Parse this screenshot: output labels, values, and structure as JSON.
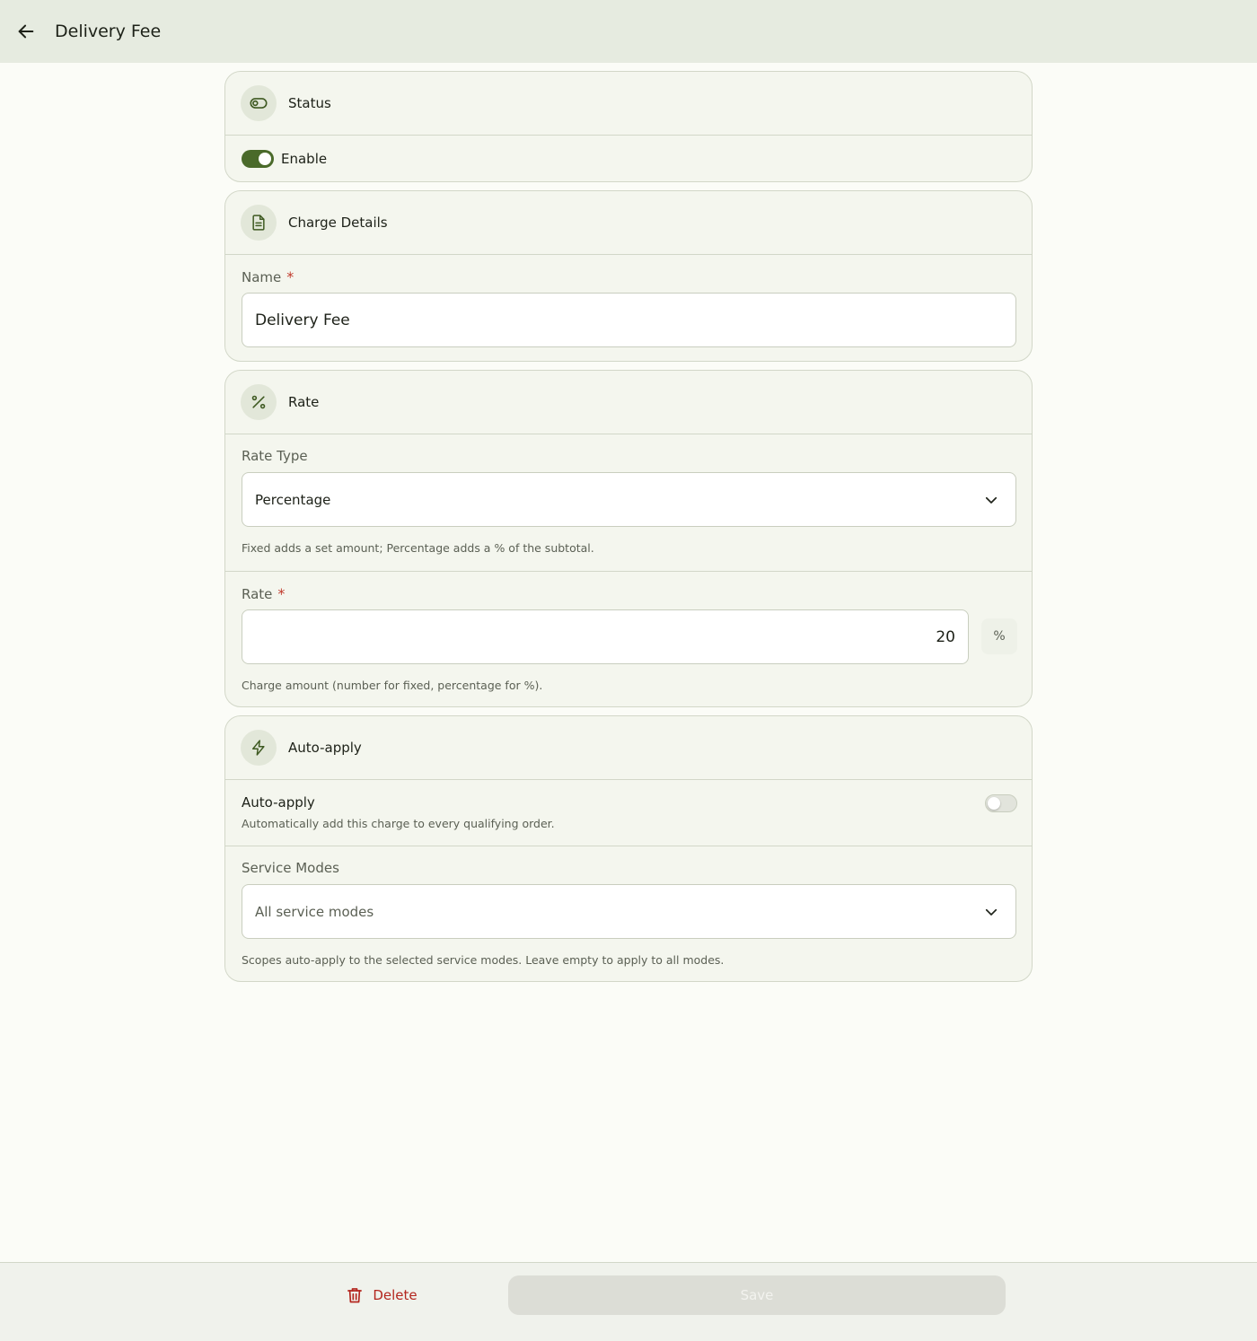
{
  "appbar": {
    "title": "Delivery Fee"
  },
  "status": {
    "title": "Status",
    "enable_label": "Enable",
    "enabled": true
  },
  "charge_details": {
    "title": "Charge Details",
    "name_label": "Name",
    "required_mark": "*",
    "name_value": "Delivery Fee"
  },
  "rate": {
    "title": "Rate",
    "rate_type_label": "Rate Type",
    "rate_type_value": "Percentage",
    "rate_type_helper": "Fixed adds a set amount; Percentage adds a % of the subtotal.",
    "rate_label": "Rate",
    "required_mark": "*",
    "rate_value": "20",
    "rate_suffix": "%",
    "rate_helper": "Charge amount (number for fixed, percentage for %)."
  },
  "auto_apply": {
    "title": "Auto-apply",
    "toggle_label": "Auto-apply",
    "toggle_description": "Automatically add this charge to every qualifying order.",
    "enabled": false,
    "service_modes_label": "Service Modes",
    "service_modes_value": "All service modes",
    "service_modes_helper": "Scopes auto-apply to the selected service modes. Leave empty to apply to all modes."
  },
  "actions": {
    "delete_label": "Delete",
    "save_label": "Save"
  },
  "colors": {
    "accent": "#4a6a2a",
    "danger": "#b3261e",
    "card_bg": "#f4f6ee",
    "appbar_bg": "#e6ebe0"
  }
}
